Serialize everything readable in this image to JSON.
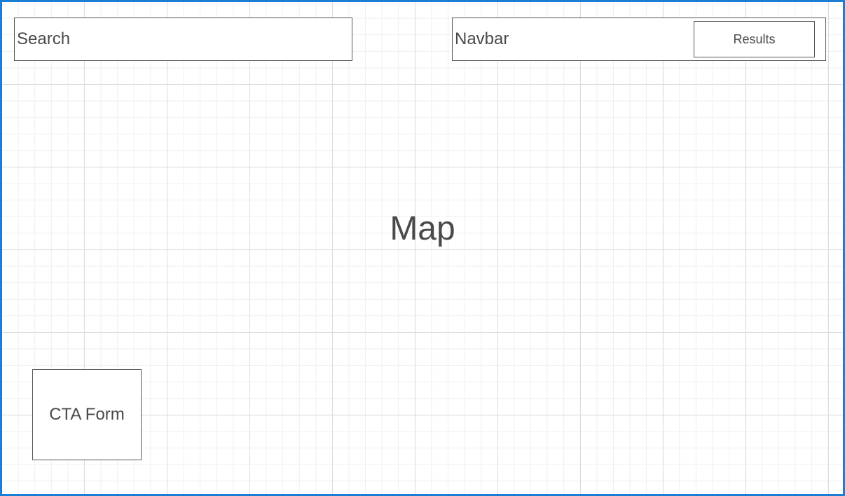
{
  "wireframe": {
    "search": {
      "label": "Search"
    },
    "navbar": {
      "label": "Navbar",
      "results_label": "Results"
    },
    "map": {
      "label": "Map"
    },
    "cta_form": {
      "label": "CTA Form"
    }
  },
  "colors": {
    "frame_border": "#1a7fd4",
    "box_border": "#555555",
    "text": "#4a4a4a",
    "grid_major": "#dcdcdc",
    "grid_minor": "#efefef"
  }
}
